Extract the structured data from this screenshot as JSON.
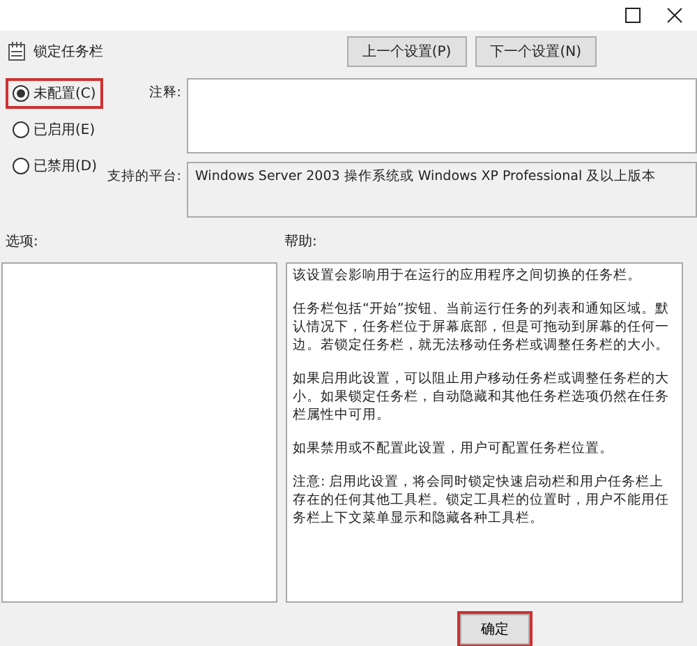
{
  "window": {
    "title": "锁定任务栏"
  },
  "nav_buttons": [
    "上一个设置(P)",
    "下一个设置(N)"
  ],
  "radios": [
    {
      "label": "未配置(C)",
      "selected": true,
      "highlighted": true
    },
    {
      "label": "已启用(E)",
      "selected": false,
      "highlighted": false
    },
    {
      "label": "已禁用(D)",
      "selected": false,
      "highlighted": false
    }
  ],
  "comment": {
    "label": "注释:"
  },
  "platform": {
    "label": "支持的平台:",
    "value": "Windows Server 2003 操作系统或 Windows XP Professional 及以上版本"
  },
  "options": {
    "label": "选项:"
  },
  "help": {
    "label": "帮助:",
    "paragraphs": [
      "该设置会影响用于在运行的应用程序之间切换的任务栏。",
      "任务栏包括“开始”按钮、当前运行任务的列表和通知区域。默认情况下，任务栏位于屏幕底部，但是可拖动到屏幕的任何一边。若锁定任务栏，就无法移动任务栏或调整任务栏的大小。",
      "如果启用此设置，可以阻止用户移动任务栏或调整任务栏的大小。如果锁定任务栏，自动隐藏和其他任务栏选项仍然在任务栏属性中可用。",
      "如果禁用或不配置此设置，用户可配置任务栏位置。",
      "注意: 启用此设置，将会同时锁定快速启动栏和用户任务栏上存在的任何其他工具栏。锁定工具栏的位置时，用户不能用任务栏上下文菜单显示和隐藏各种工具栏。"
    ]
  },
  "footer_buttons": [
    {
      "label": "确定",
      "highlighted": true
    }
  ]
}
